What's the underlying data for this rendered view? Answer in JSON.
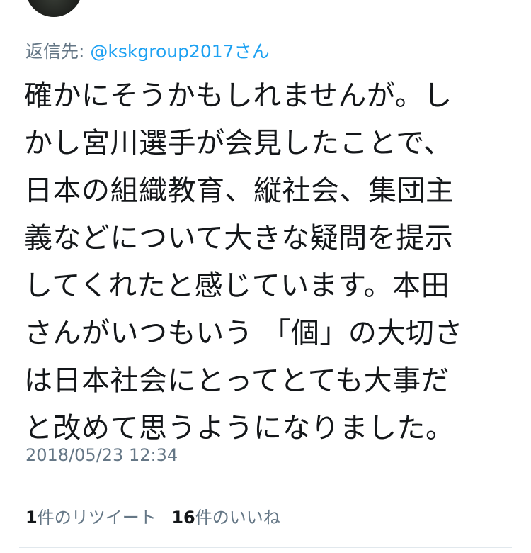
{
  "reply": {
    "prefix": "返信先: ",
    "handle": "@kskgroup2017さん"
  },
  "tweet": {
    "lines": [
      "確かにそうかもしれませんが。し",
      "かし宮川選手が会見したことで、",
      "日本の組織教育、縦社会、集団主",
      "義などについて大きな疑問を提示",
      "してくれたと感じています。本田",
      "さんがいつもいう 「個」の大切さ",
      "は日本社会にとってとても大事だ",
      "と改めて思うようになりました。"
    ]
  },
  "timestamp": "2018/05/23 12:34",
  "stats": {
    "retweets": {
      "count": "1",
      "label": "件のリツイート"
    },
    "likes": {
      "count": "16",
      "label": "件のいいね"
    }
  },
  "colors": {
    "text": "#14171a",
    "secondary": "#657786",
    "link": "#1da1f2",
    "divider": "#e1e8ed"
  }
}
